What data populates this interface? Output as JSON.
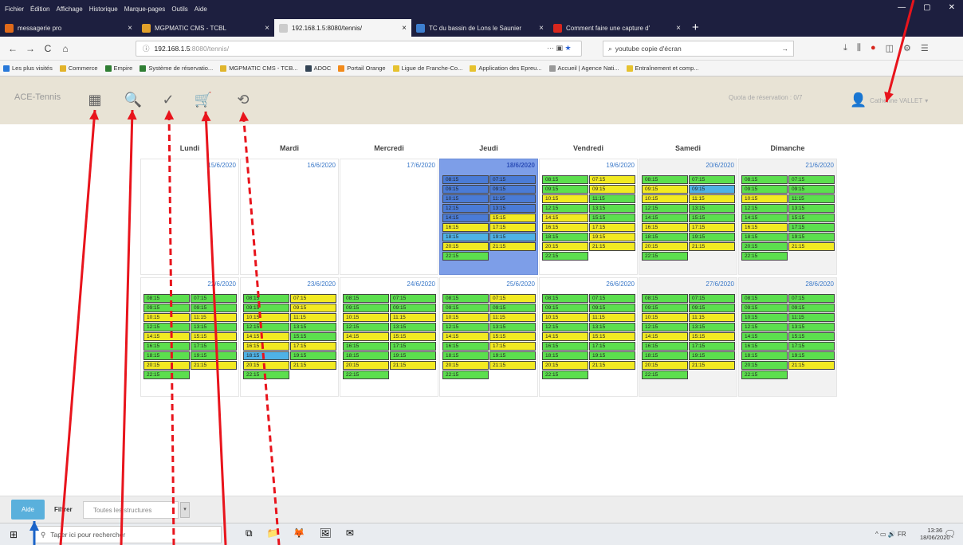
{
  "browser": {
    "menu": [
      "Fichier",
      "Édition",
      "Affichage",
      "Historique",
      "Marque-pages",
      "Outils",
      "Aide"
    ],
    "window_controls": [
      "—",
      "▢",
      "✕"
    ],
    "tabs": [
      {
        "label": "messagerie pro",
        "color": "#e06a1a",
        "active": false
      },
      {
        "label": "MGPMATIC CMS - TCBL",
        "color": "#e1a02a",
        "active": false
      },
      {
        "label": "192.168.1.5:8080/tennis/",
        "color": "#cccccc",
        "active": true
      },
      {
        "label": "TC du bassin de Lons le Saunier",
        "color": "#3e7fd0",
        "active": false
      },
      {
        "label": "Comment faire une capture d'",
        "color": "#d7261d",
        "active": false
      }
    ],
    "new_tab": "+",
    "url": "192.168.1.5",
    "url_tail": ":8080/tennis/",
    "url_actions": "··· ▣",
    "url_star": "★",
    "search_text": "youtube copie d'écran",
    "nav_buttons": [
      "←",
      "→",
      "C",
      "⌂"
    ],
    "nav_right_icons": [
      "⤓",
      "⫼",
      "●",
      "◫",
      "⚙",
      "☰"
    ],
    "bookmarks": [
      {
        "label": "Les plus visités",
        "color": "#2979d9"
      },
      {
        "label": "Commerce",
        "color": "#e2b32a"
      },
      {
        "label": "Empire",
        "color": "#2f7e33"
      },
      {
        "label": "Système de réservatio...",
        "color": "#2f7e33"
      },
      {
        "label": "MGPMATIC CMS - TCB...",
        "color": "#e0b52c"
      },
      {
        "label": "ADOC",
        "color": "#345"
      },
      {
        "label": "Portail Orange",
        "color": "#f28a1a"
      },
      {
        "label": "Ligue de Franche-Co...",
        "color": "#e6c22f"
      },
      {
        "label": "Application des Epreu...",
        "color": "#e6c22f"
      },
      {
        "label": "Accueil | Agence Nati...",
        "color": "#999"
      },
      {
        "label": "Entraînement et comp...",
        "color": "#e6c22f"
      }
    ]
  },
  "app": {
    "brand": "ACE-Tennis",
    "header_icons": [
      {
        "name": "calendar-icon",
        "glyph": "▦"
      },
      {
        "name": "search-icon",
        "glyph": "🔍"
      },
      {
        "name": "checkmark-icon",
        "glyph": "✓"
      },
      {
        "name": "cart-icon",
        "glyph": "🛒"
      },
      {
        "name": "history-icon",
        "glyph": "⟲"
      }
    ],
    "observation_quota": "Quota de réservation : 0/7",
    "user_name": "Catherine VALLET",
    "user_caret": "▾",
    "days": [
      "Lundi",
      "Mardi",
      "Mercredi",
      "Jeudi",
      "Vendredi",
      "Samedi",
      "Dimanche"
    ],
    "weeks": [
      [
        "15/6/2020",
        "16/6/2020",
        "17/6/2020",
        "18/6/2020",
        "19/6/2020",
        "20/6/2020",
        "21/6/2020"
      ],
      [
        "22/6/2020",
        "23/6/2020",
        "24/6/2020",
        "25/6/2020",
        "26/6/2020",
        "27/6/2020",
        "28/6/2020"
      ]
    ],
    "slot_times": [
      "08:15",
      "07:15",
      "09:15",
      "09:15",
      "10:15",
      "11:15",
      "12:15",
      "13:15",
      "14:15",
      "15:15",
      "16:15",
      "17:15",
      "18:15",
      "19:15",
      "20:15",
      "21:15",
      "22:15"
    ],
    "slot_colors": {
      "free": "#5cdf4e",
      "partial": "#f2ea22",
      "past": "#4a7bd6",
      "mine": "#4fb2e6"
    },
    "today_color": "#7d9ee8",
    "print_button": "Aide",
    "filter_label": "Filtrer",
    "filter_value": "Toutes les structures",
    "filter_caret": "▾"
  },
  "taskbar": {
    "search_placeholder": "Taper ici pour rechercher",
    "windows_logo": "⊞",
    "apps": [
      "⧉",
      "📁",
      "🦊",
      "🖼",
      "✉"
    ],
    "tray_icons": "^ ▭ 🔊 FR",
    "time": "13:36",
    "date": "18/06/2020",
    "notification": "🗨"
  },
  "annotation_color": "#e8141c",
  "annotation_blue": "#1a63c8"
}
